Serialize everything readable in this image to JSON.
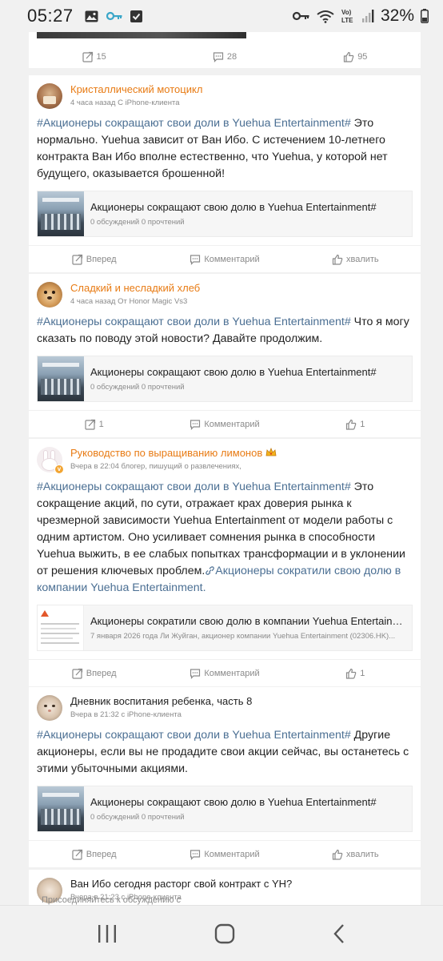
{
  "status_bar": {
    "time": "05:27",
    "battery": "32%"
  },
  "top_card": {
    "forward": "15",
    "comment": "28",
    "like": "95"
  },
  "posts": [
    {
      "name": "Кристаллический мотоцикл",
      "meta": "4 часа назад С iPhone-клиента",
      "hashtag": "#Акционеры сокращают свои доли в Yuehua Entertainment#",
      "text": " Это нормально. Yuehua зависит от Ван Ибо. С истечением 10-летнего контракта Ван Ибо вполне естественно, что Yuehua, у которой нет будущего, оказывается брошенной!",
      "ref_title": "Акционеры сокращают свою долю в Yuehua Entertainment#",
      "ref_sub": "0 обсуждений 0 прочтений",
      "forward": "Вперед",
      "comment": "Комментарий",
      "like": "хвалить"
    },
    {
      "name": "Сладкий и несладкий хлеб",
      "meta": "4 часа назад От Honor Magic Vs3",
      "hashtag": "#Акционеры сокращают свои доли в Yuehua Entertainment#",
      "text": " Что я могу сказать по поводу этой новости? Давайте продолжим.",
      "ref_title": "Акционеры сокращают свою долю в Yuehua Entertainment#",
      "ref_sub": "0 обсуждений 0 прочтений",
      "forward": "1",
      "comment": "Комментарий",
      "like": "1"
    },
    {
      "name": "Руководство по выращиванию лимонов",
      "meta": "Вчера в 22:04 блогер, пишущий о развлечениях,",
      "hashtag": "#Акционеры сокращают свои доли в Yuehua Entertainment#",
      "text": " Это сокращение акций, по сути, отражает крах доверия рынка к чрезмерной зависимости Yuehua Entertainment от модели работы с одним артистом. Оно усиливает сомнения рынка в способности Yuehua выжить, в ее слабых попытках трансформации и в уклонении от решения ключевых проблем.",
      "link": "Акционеры сократили свою долю в компании Yuehua Entertainment.",
      "ref_title": "Акционеры сократили свою долю в компании Yuehua Entertainment",
      "ref_sub": "7 января 2026 года Ли Жуйган, акционер компании Yuehua Entertainment (02306.HK)...",
      "forward": "Вперед",
      "comment": "Комментарий",
      "like": "1"
    },
    {
      "name": "Дневник воспитания ребенка, часть 8",
      "meta": "Вчера в 21:32 с iPhone-клиента",
      "hashtag": "#Акционеры сокращают свои доли в Yuehua Entertainment#",
      "text": " Другие акционеры, если вы не продадите свои акции сейчас, вы останетесь с этими убыточными акциями.",
      "ref_title": "Акционеры сокращают свою долю в Yuehua Entertainment#",
      "ref_sub": "0 обсуждений 0 прочтений",
      "forward": "Вперед",
      "comment": "Комментарий",
      "like": "хвалить"
    },
    {
      "name": "Ван Ибо сегодня расторг свой контракт с YH?",
      "meta": "Вчера в 21:23 с iPhone-клиента",
      "overlay": "Присоединяйтесь к обсуждению с"
    }
  ],
  "icons": {
    "forward": "share-forward-icon",
    "comment": "comment-bubble-icon",
    "like": "thumbs-up-icon",
    "crown": "crown-badge-icon"
  },
  "colors": {
    "accent_link": "#4b6f93",
    "username_orange": "#e87b14",
    "meta_gray": "#8a8a8a",
    "background": "#f1f1f1"
  }
}
